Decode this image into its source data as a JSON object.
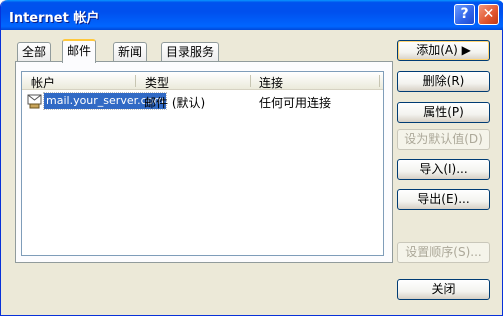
{
  "window": {
    "title": "Internet 帐户",
    "help_glyph": "?",
    "close_glyph": "✕"
  },
  "tabs": [
    {
      "label": "全部"
    },
    {
      "label": "邮件"
    },
    {
      "label": "新闻"
    },
    {
      "label": "目录服务"
    }
  ],
  "list": {
    "columns": [
      "帐户",
      "类型",
      "连接"
    ],
    "rows": [
      {
        "account": "mail.your_server.com",
        "type": "邮件 (默认)",
        "connection": "任何可用连接"
      }
    ]
  },
  "buttons": {
    "add": "添加(A) ▶",
    "remove": "删除(R)",
    "properties": "属性(P)",
    "set_default": "设为默认值(D)",
    "import": "导入(I)...",
    "export": "导出(E)...",
    "order": "设置顺序(S)...",
    "close": "关闭"
  }
}
